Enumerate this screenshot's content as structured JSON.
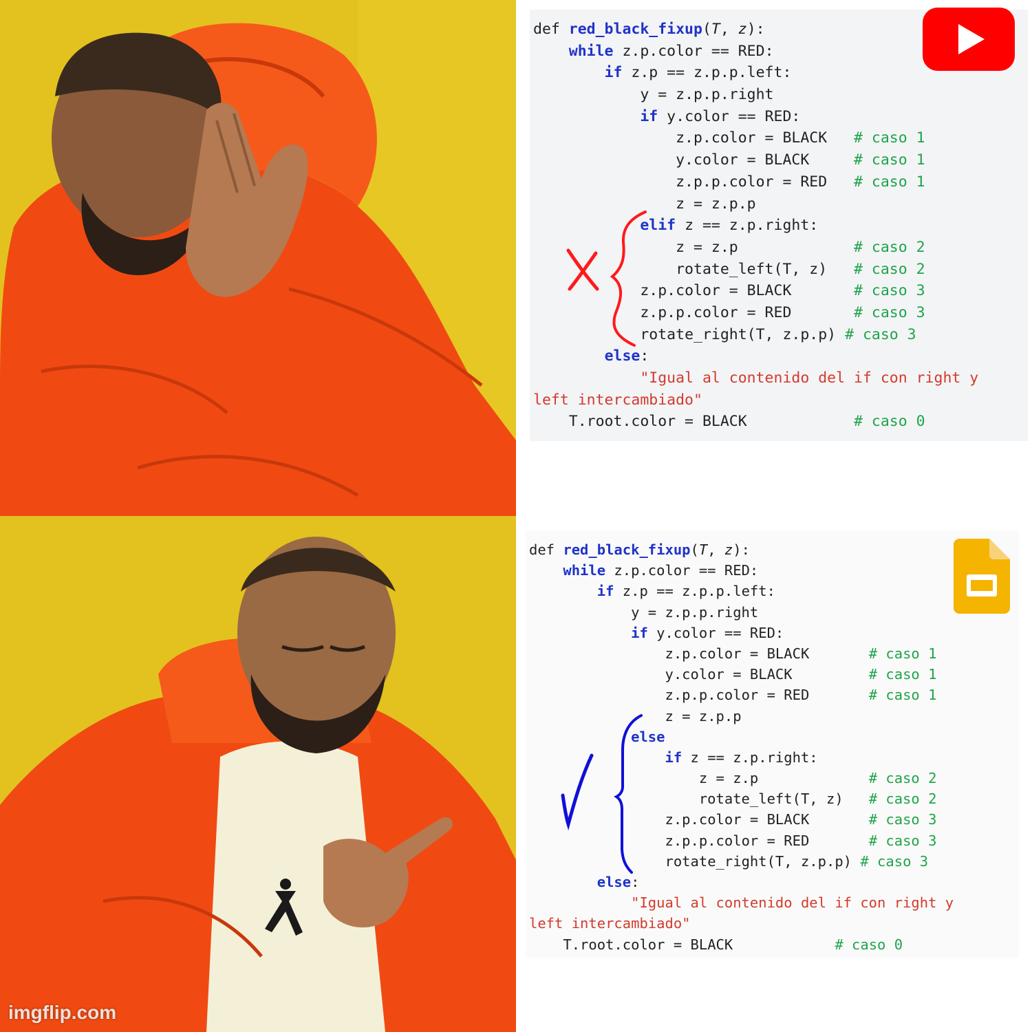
{
  "watermark": "imgflip.com",
  "colors": {
    "panel_background": "#e3c21f",
    "jacket": "#f04a12",
    "keyword_blue": "#1f33c9",
    "comment_green": "#1ea44a",
    "string_red": "#d33a2c",
    "annotation_red": "#ff1a1a",
    "annotation_blue": "#1010d8"
  },
  "top_panel": {
    "logo": "youtube-play-icon",
    "mark": "cross-mark",
    "code": [
      {
        "indent": 0,
        "parts": [
          {
            "t": "def ",
            "c": ""
          },
          {
            "t": "red_black_fixup",
            "c": "fn"
          },
          {
            "t": "(",
            "c": ""
          },
          {
            "t": "T",
            "c": "arg"
          },
          {
            "t": ", ",
            "c": ""
          },
          {
            "t": "z",
            "c": "arg"
          },
          {
            "t": "):",
            "c": ""
          }
        ]
      },
      {
        "indent": 4,
        "parts": [
          {
            "t": "while",
            "c": "kw"
          },
          {
            "t": " z.p.color == RED:",
            "c": ""
          }
        ]
      },
      {
        "indent": 8,
        "parts": [
          {
            "t": "if",
            "c": "kw"
          },
          {
            "t": " z.p == z.p.p.left:",
            "c": ""
          }
        ]
      },
      {
        "indent": 12,
        "parts": [
          {
            "t": "y = z.p.p.right",
            "c": ""
          }
        ]
      },
      {
        "indent": 12,
        "parts": [
          {
            "t": "if",
            "c": "kw"
          },
          {
            "t": " y.color == RED:",
            "c": ""
          }
        ]
      },
      {
        "indent": 16,
        "parts": [
          {
            "t": "z.p.color = BLACK   ",
            "c": ""
          },
          {
            "t": "# caso 1",
            "c": "cm"
          }
        ]
      },
      {
        "indent": 16,
        "parts": [
          {
            "t": "y.color = BLACK     ",
            "c": ""
          },
          {
            "t": "# caso 1",
            "c": "cm"
          }
        ]
      },
      {
        "indent": 16,
        "parts": [
          {
            "t": "z.p.p.color = RED   ",
            "c": ""
          },
          {
            "t": "# caso 1",
            "c": "cm"
          }
        ]
      },
      {
        "indent": 16,
        "parts": [
          {
            "t": "z = z.p.p",
            "c": ""
          }
        ]
      },
      {
        "indent": 12,
        "parts": [
          {
            "t": "elif",
            "c": "kw"
          },
          {
            "t": " z == z.p.right:",
            "c": ""
          }
        ]
      },
      {
        "indent": 16,
        "parts": [
          {
            "t": "z = z.p             ",
            "c": ""
          },
          {
            "t": "# caso 2",
            "c": "cm"
          }
        ]
      },
      {
        "indent": 16,
        "parts": [
          {
            "t": "rotate_left(T, z)   ",
            "c": ""
          },
          {
            "t": "# caso 2",
            "c": "cm"
          }
        ]
      },
      {
        "indent": 12,
        "parts": [
          {
            "t": "z.p.color = BLACK       ",
            "c": ""
          },
          {
            "t": "# caso 3",
            "c": "cm"
          }
        ]
      },
      {
        "indent": 12,
        "parts": [
          {
            "t": "z.p.p.color = RED       ",
            "c": ""
          },
          {
            "t": "# caso 3",
            "c": "cm"
          }
        ]
      },
      {
        "indent": 12,
        "parts": [
          {
            "t": "rotate_right(T, z.p.p) ",
            "c": ""
          },
          {
            "t": "# caso 3",
            "c": "cm"
          }
        ]
      },
      {
        "indent": 8,
        "parts": [
          {
            "t": "else",
            "c": "kw"
          },
          {
            "t": ":",
            "c": ""
          }
        ]
      },
      {
        "indent": 12,
        "parts": [
          {
            "t": "\"Igual al contenido del if con right y",
            "c": "str"
          }
        ]
      },
      {
        "indent": 0,
        "parts": [
          {
            "t": "left intercambiado\"",
            "c": "str"
          }
        ]
      },
      {
        "indent": 4,
        "parts": [
          {
            "t": "T.root.color = BLACK            ",
            "c": ""
          },
          {
            "t": "# caso 0",
            "c": "cm"
          }
        ]
      }
    ]
  },
  "bottom_panel": {
    "logo": "google-slides-icon",
    "mark": "check-mark",
    "code": [
      {
        "indent": 0,
        "parts": [
          {
            "t": "def ",
            "c": ""
          },
          {
            "t": "red_black_fixup",
            "c": "fn"
          },
          {
            "t": "(",
            "c": ""
          },
          {
            "t": "T",
            "c": "arg"
          },
          {
            "t": ", ",
            "c": ""
          },
          {
            "t": "z",
            "c": "arg"
          },
          {
            "t": "):",
            "c": ""
          }
        ]
      },
      {
        "indent": 4,
        "parts": [
          {
            "t": "while",
            "c": "kw"
          },
          {
            "t": " z.p.color == RED:",
            "c": ""
          }
        ]
      },
      {
        "indent": 8,
        "parts": [
          {
            "t": "if",
            "c": "kw"
          },
          {
            "t": " z.p == z.p.p.left:",
            "c": ""
          }
        ]
      },
      {
        "indent": 12,
        "parts": [
          {
            "t": "y = z.p.p.right",
            "c": ""
          }
        ]
      },
      {
        "indent": 12,
        "parts": [
          {
            "t": "if",
            "c": "kw"
          },
          {
            "t": " y.color == RED:",
            "c": ""
          }
        ]
      },
      {
        "indent": 16,
        "parts": [
          {
            "t": "z.p.color = BLACK       ",
            "c": ""
          },
          {
            "t": "# caso 1",
            "c": "cm"
          }
        ]
      },
      {
        "indent": 16,
        "parts": [
          {
            "t": "y.color = BLACK         ",
            "c": ""
          },
          {
            "t": "# caso 1",
            "c": "cm"
          }
        ]
      },
      {
        "indent": 16,
        "parts": [
          {
            "t": "z.p.p.color = RED       ",
            "c": ""
          },
          {
            "t": "# caso 1",
            "c": "cm"
          }
        ]
      },
      {
        "indent": 16,
        "parts": [
          {
            "t": "z = z.p.p",
            "c": ""
          }
        ]
      },
      {
        "indent": 12,
        "parts": [
          {
            "t": "else",
            "c": "kw"
          }
        ]
      },
      {
        "indent": 16,
        "parts": [
          {
            "t": "if",
            "c": "kw"
          },
          {
            "t": " z == z.p.right:",
            "c": ""
          }
        ]
      },
      {
        "indent": 20,
        "parts": [
          {
            "t": "z = z.p             ",
            "c": ""
          },
          {
            "t": "# caso 2",
            "c": "cm"
          }
        ]
      },
      {
        "indent": 20,
        "parts": [
          {
            "t": "rotate_left(T, z)   ",
            "c": ""
          },
          {
            "t": "# caso 2",
            "c": "cm"
          }
        ]
      },
      {
        "indent": 16,
        "parts": [
          {
            "t": "z.p.color = BLACK       ",
            "c": ""
          },
          {
            "t": "# caso 3",
            "c": "cm"
          }
        ]
      },
      {
        "indent": 16,
        "parts": [
          {
            "t": "z.p.p.color = RED       ",
            "c": ""
          },
          {
            "t": "# caso 3",
            "c": "cm"
          }
        ]
      },
      {
        "indent": 16,
        "parts": [
          {
            "t": "rotate_right(T, z.p.p) ",
            "c": ""
          },
          {
            "t": "# caso 3",
            "c": "cm"
          }
        ]
      },
      {
        "indent": 8,
        "parts": [
          {
            "t": "else",
            "c": "kw"
          },
          {
            "t": ":",
            "c": ""
          }
        ]
      },
      {
        "indent": 12,
        "parts": [
          {
            "t": "\"Igual al contenido del if con right y",
            "c": "str"
          }
        ]
      },
      {
        "indent": 0,
        "parts": [
          {
            "t": "left intercambiado\"",
            "c": "str"
          }
        ]
      },
      {
        "indent": 4,
        "parts": [
          {
            "t": "T.root.color = BLACK            ",
            "c": ""
          },
          {
            "t": "# caso 0",
            "c": "cm"
          }
        ]
      }
    ]
  }
}
